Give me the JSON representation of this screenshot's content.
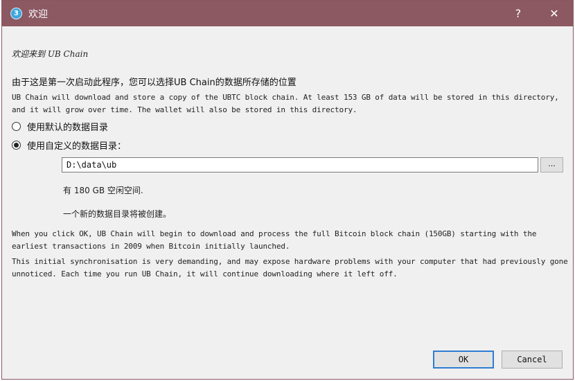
{
  "window": {
    "title": "欢迎",
    "app_icon_glyph": "3",
    "help_glyph": "?",
    "close_glyph": "✕",
    "titlebar_color": "#8c5862"
  },
  "intro": {
    "welcome_text": "欢迎来到 UB Chain",
    "heading": "由于这是第一次启动此程序，您可以选择UB Chain的数据所存储的位置",
    "description": "UB Chain will download and store a copy of the UBTC block chain. At least 153 GB of data will be stored in this directory, and it will grow over time. The wallet will also be stored in this directory."
  },
  "options": {
    "default_dir_label": "使用默认的数据目录",
    "custom_dir_label": "使用自定义的数据目录：",
    "selected": "custom"
  },
  "path": {
    "value": "D:\\data\\ub",
    "browse_label": "..."
  },
  "info": {
    "free_space": "有 180 GB 空闲空间.",
    "new_dir": "一个新的数据目录将被创建。"
  },
  "notes": {
    "para1": "When you click OK, UB Chain will begin to download and process the full Bitcoin block chain (150GB) starting with the earliest transactions in 2009 when Bitcoin initially launched.",
    "para2": "This initial synchronisation is very demanding, and may expose hardware problems with your computer that had previously gone unnoticed. Each time you run UB Chain, it will continue downloading where it left off."
  },
  "buttons": {
    "ok": "OK",
    "cancel": "Cancel"
  }
}
